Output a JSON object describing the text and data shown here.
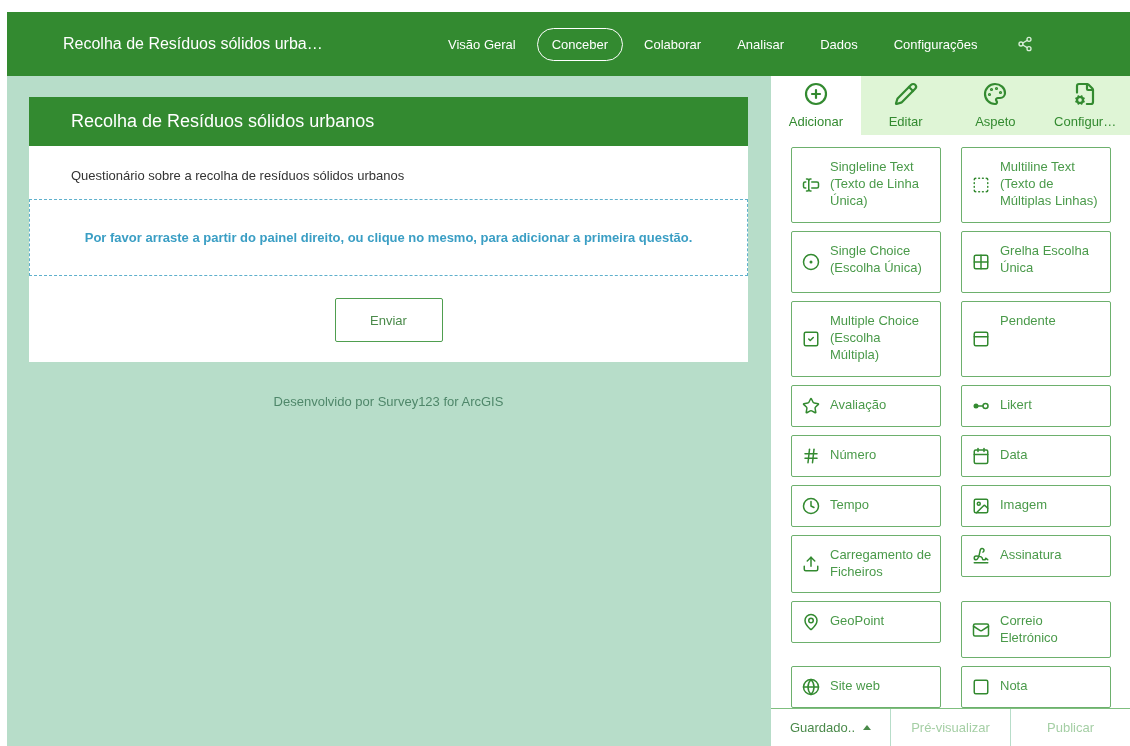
{
  "header": {
    "title": "Recolha de Resíduos sólidos urba…",
    "nav": [
      {
        "label": "Visão Geral",
        "selected": false
      },
      {
        "label": "Conceber",
        "selected": true
      },
      {
        "label": "Colaborar",
        "selected": false
      },
      {
        "label": "Analisar",
        "selected": false
      },
      {
        "label": "Dados",
        "selected": false
      },
      {
        "label": "Configurações",
        "selected": false
      }
    ]
  },
  "form": {
    "title": "Recolha de Resíduos sólidos urbanos",
    "description": "Questionário sobre a recolha de resíduos sólidos urbanos",
    "drop_hint": "Por favor arraste a partir do painel direito, ou clique no mesmo, para adicionar a primeira questão.",
    "submit": "Enviar",
    "footer": "Desenvolvido por Survey123 for ArcGIS"
  },
  "panel": {
    "tabs": [
      {
        "label": "Adicionar",
        "kind": "add",
        "selected": true
      },
      {
        "label": "Editar",
        "kind": "edit",
        "selected": false
      },
      {
        "label": "Aspeto",
        "kind": "palette",
        "selected": false
      },
      {
        "label": "Configur…",
        "kind": "settings",
        "selected": false
      }
    ],
    "items": [
      {
        "label": "Singleline Text (Texto de Linha Única)",
        "kind": "singleline"
      },
      {
        "label": "Multiline Text (Texto de Múltiplas Linhas)",
        "kind": "multiline"
      },
      {
        "label": "Single Choice (Escolha Única)",
        "kind": "single"
      },
      {
        "label": "Grelha Escolha Única",
        "kind": "grid"
      },
      {
        "label": "Multiple Choice (Escolha Múltipla)",
        "kind": "multiple"
      },
      {
        "label": "Pendente",
        "kind": "dropdown"
      },
      {
        "label": "Avaliação",
        "kind": "star"
      },
      {
        "label": "Likert",
        "kind": "likert"
      },
      {
        "label": "Número",
        "kind": "number"
      },
      {
        "label": "Data",
        "kind": "date"
      },
      {
        "label": "Tempo",
        "kind": "time"
      },
      {
        "label": "Imagem",
        "kind": "image"
      },
      {
        "label": "Carregamento de Ficheiros",
        "kind": "upload"
      },
      {
        "label": "Assinatura",
        "kind": "signature"
      },
      {
        "label": "GeoPoint",
        "kind": "geopoint"
      },
      {
        "label": "Correio Eletrónico",
        "kind": "email"
      },
      {
        "label": "Site web",
        "kind": "web"
      },
      {
        "label": "Nota",
        "kind": "note"
      }
    ],
    "footer": [
      {
        "label": "Guardado..",
        "kind": "menu",
        "disabled": false
      },
      {
        "label": "Pré-visualizar",
        "kind": "plain",
        "disabled": true
      },
      {
        "label": "Publicar",
        "kind": "plain",
        "disabled": true
      }
    ]
  }
}
